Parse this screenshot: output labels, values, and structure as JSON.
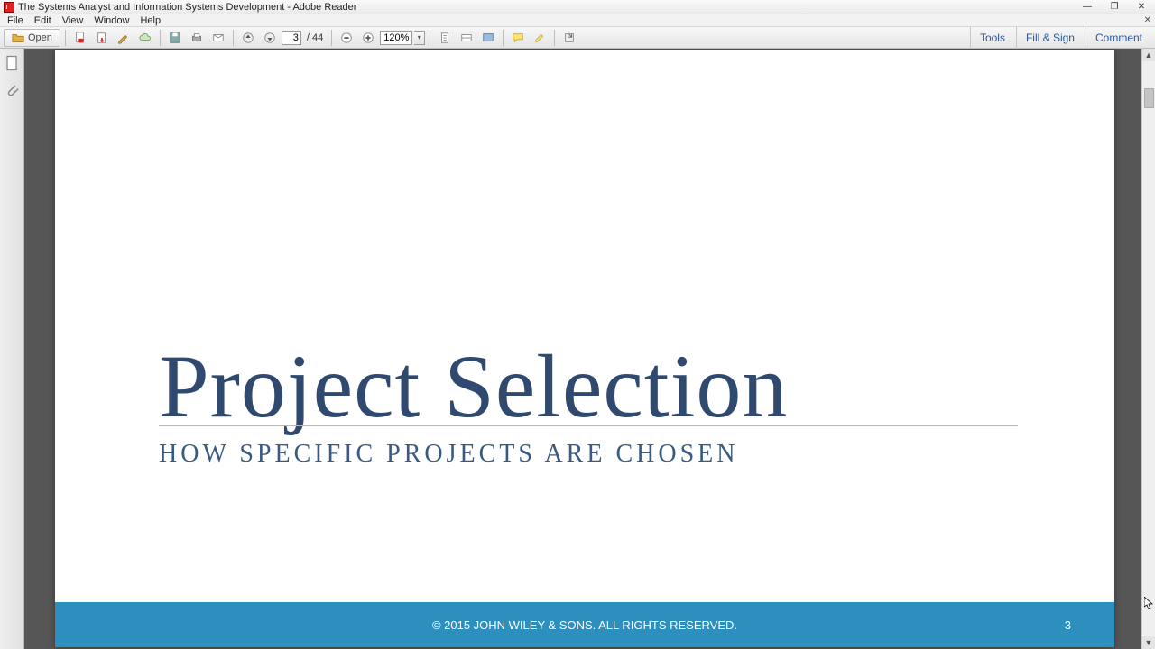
{
  "window": {
    "title": "The Systems Analyst and Information Systems Development - Adobe Reader"
  },
  "menu": {
    "file": "File",
    "edit": "Edit",
    "view": "View",
    "window": "Window",
    "help": "Help"
  },
  "toolbar": {
    "open_label": "Open",
    "page_current": "3",
    "page_total": "/ 44",
    "zoom_value": "120%"
  },
  "right_tabs": {
    "tools": "Tools",
    "fill_sign": "Fill & Sign",
    "comment": "Comment"
  },
  "slide": {
    "title": "Project Selection",
    "subtitle": "HOW SPECIFIC PROJECTS ARE CHOSEN",
    "footer": "© 2015 JOHN WILEY & SONS.  ALL RIGHTS RESERVED.",
    "page_number": "3"
  }
}
